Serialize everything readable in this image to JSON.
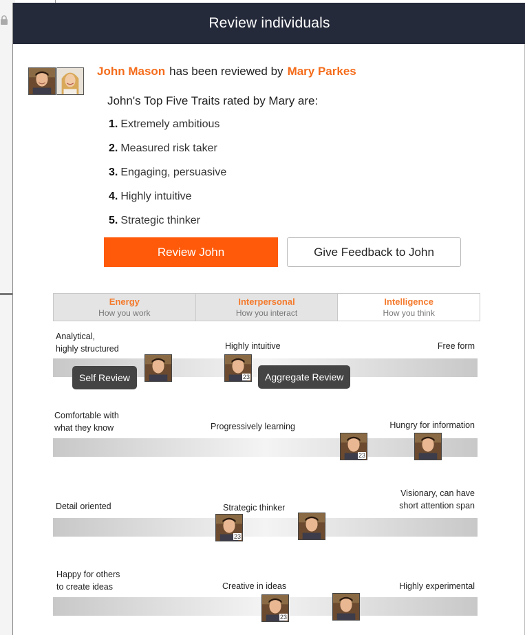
{
  "window": {
    "title": "Review individuals"
  },
  "review": {
    "reviewee": "John Mason",
    "connector": "has been reviewed by",
    "reviewer": "Mary Parkes",
    "traits_intro": "John's Top Five Traits rated by Mary are:",
    "traits": [
      {
        "num": "1.",
        "text": "Extremely ambitious"
      },
      {
        "num": "2.",
        "text": "Measured risk taker"
      },
      {
        "num": "3.",
        "text": "Engaging, persuasive"
      },
      {
        "num": "4.",
        "text": "Highly intuitive"
      },
      {
        "num": "5.",
        "text": "Strategic thinker"
      }
    ]
  },
  "actions": {
    "primary": "Review John",
    "secondary": "Give Feedback to John"
  },
  "tabs": [
    {
      "title": "Energy",
      "subtitle": "How you work",
      "active": false
    },
    {
      "title": "Interpersonal",
      "subtitle": "How you interact",
      "active": false
    },
    {
      "title": "Intelligence",
      "subtitle": "How you think",
      "active": true
    }
  ],
  "scales": [
    {
      "left": "Analytical,\nhighly structured",
      "middle": "Highly intuitive",
      "right": "Free form",
      "self_count": "",
      "aggregate_count": "23"
    },
    {
      "left": "Comfortable with\nwhat they know",
      "middle": "Progressively learning",
      "right": "Hungry for information",
      "self_count": "",
      "aggregate_count": "23"
    },
    {
      "left": "Detail oriented",
      "middle": "Strategic thinker",
      "right": "Visionary, can have\nshort attention span",
      "self_count": "",
      "aggregate_count": "23"
    },
    {
      "left": "Happy for others\nto create ideas",
      "middle": "Creative in ideas",
      "right": "Highly experimental",
      "self_count": "",
      "aggregate_count": "23"
    }
  ],
  "tooltips": {
    "self": "Self Review",
    "aggregate": "Aggregate Review"
  },
  "icons": {
    "lock": "lock-icon"
  },
  "colors": {
    "accent": "#f46c1b",
    "button": "#fe5a0a",
    "header": "#252a3a"
  }
}
